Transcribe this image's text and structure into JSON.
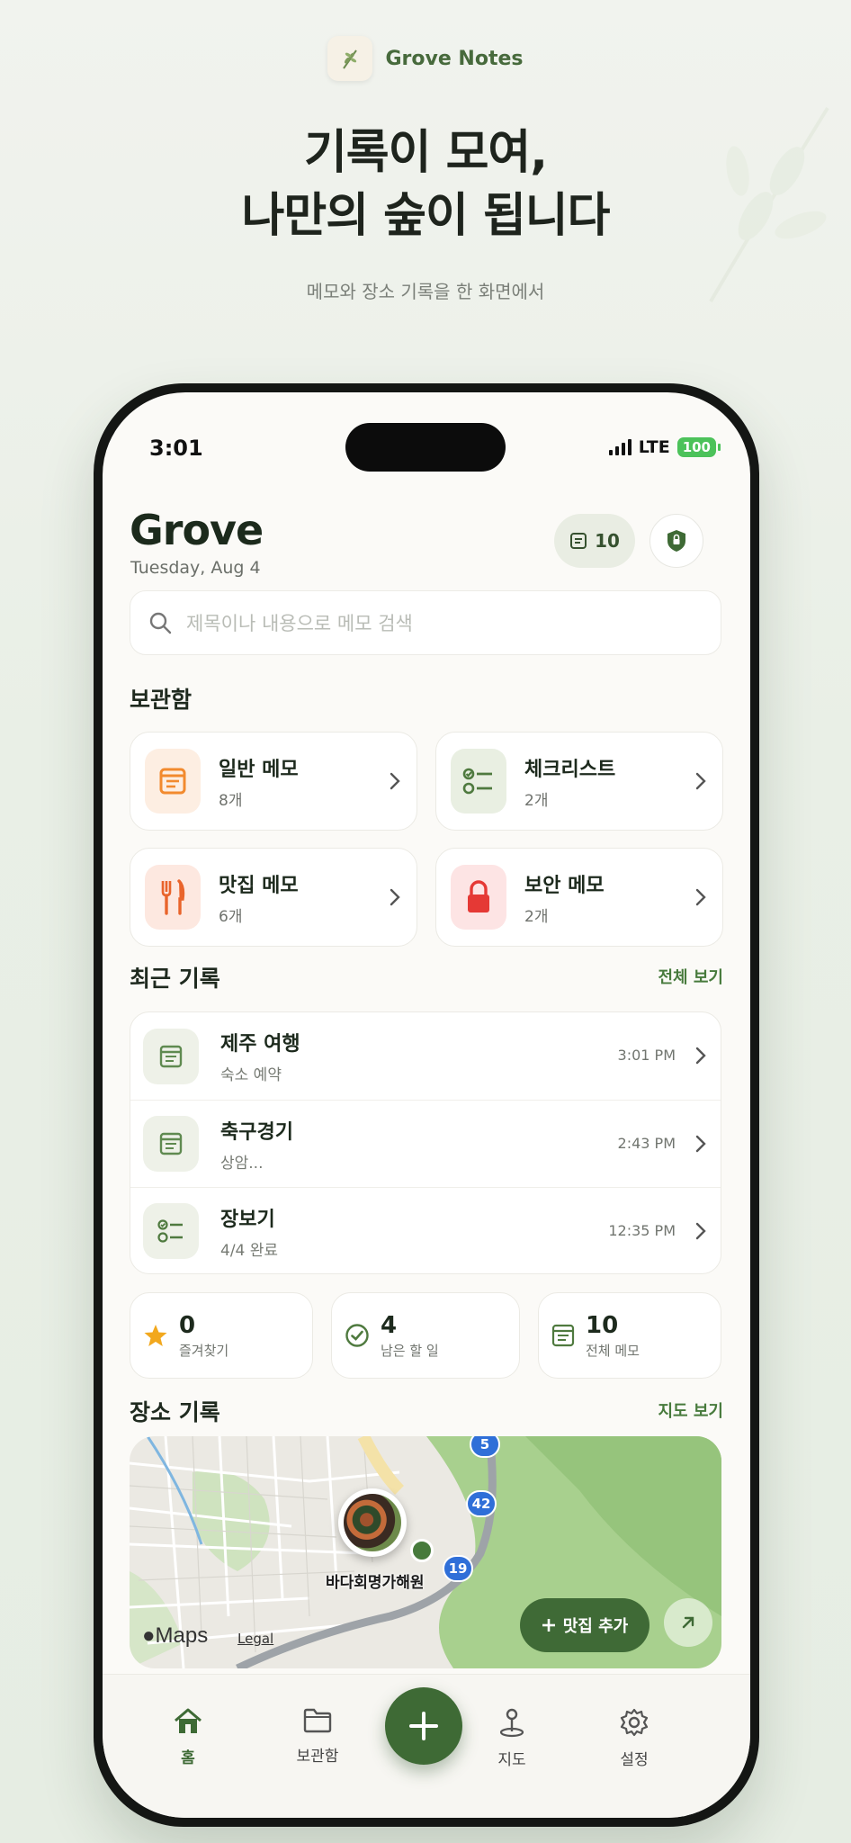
{
  "promo": {
    "brand_name": "Grove Notes",
    "headline_line1": "기록이 모여,",
    "headline_line2": "나만의 숲이 됩니다",
    "subline": "메모와 장소 기록을 한 화면에서"
  },
  "status_bar": {
    "time": "3:01",
    "network": "LTE",
    "battery": "100"
  },
  "header": {
    "title": "Grove",
    "date": "Tuesday, Aug 4",
    "note_count": "10"
  },
  "search": {
    "placeholder": "제목이나 내용으로 메모 검색"
  },
  "vault": {
    "title": "보관함",
    "folders": [
      {
        "label": "일반 메모",
        "count": "8개",
        "icon": "notepad-icon",
        "color": "#f28a2e"
      },
      {
        "label": "체크리스트",
        "count": "2개",
        "icon": "checklist-icon",
        "color": "#4f7a3f"
      },
      {
        "label": "맛집 메모",
        "count": "6개",
        "icon": "fork-knife-icon",
        "color": "#e9642b"
      },
      {
        "label": "보안 메모",
        "count": "2개",
        "icon": "lock-icon",
        "color": "#e53935"
      }
    ]
  },
  "recent": {
    "title": "최근 기록",
    "see_all": "전체 보기",
    "items": [
      {
        "title": "제주 여행",
        "subtitle": "숙소 예약",
        "time": "3:01 PM",
        "icon": "note-icon"
      },
      {
        "title": "축구경기",
        "subtitle": "상암...",
        "time": "2:43 PM",
        "icon": "note-icon"
      },
      {
        "title": "장보기",
        "subtitle": "4/4 완료",
        "time": "12:35 PM",
        "icon": "checklist-icon"
      }
    ]
  },
  "stats": [
    {
      "value": "0",
      "label": "즐겨찾기",
      "icon": "star-icon"
    },
    {
      "value": "4",
      "label": "남은 할 일",
      "icon": "check-circle-icon"
    },
    {
      "value": "10",
      "label": "전체 메모",
      "icon": "note-icon"
    }
  ],
  "places": {
    "title": "장소 기록",
    "map_link": "지도 보기",
    "place_name": "바다회명가해원",
    "road_badges": [
      "5",
      "42",
      "19"
    ],
    "maps_brand": "Maps",
    "legal": "Legal",
    "add_button": "맛집 추가"
  },
  "tabs": [
    {
      "label": "홈",
      "icon": "home-icon",
      "active": true
    },
    {
      "label": "보관함",
      "icon": "folder-icon",
      "active": false
    },
    {
      "label": "지도",
      "icon": "map-pin-icon",
      "active": false
    },
    {
      "label": "설정",
      "icon": "gear-icon",
      "active": false
    }
  ],
  "colors": {
    "accent": "#3e6a35",
    "background": "#fbfaf7"
  }
}
